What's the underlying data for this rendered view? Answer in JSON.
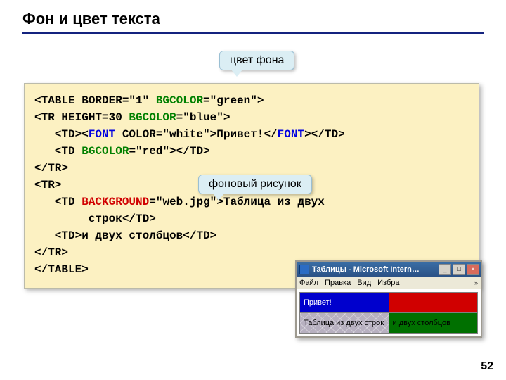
{
  "title": "Фон и цвет текста",
  "callouts": {
    "bgcolor": "цвет фона",
    "background": "фоновый рисунок"
  },
  "code": {
    "l1_a": "<TABLE BORDER=\"1\" ",
    "l1_attr": "BGCOLOR",
    "l1_b": "=\"green\">",
    "l2_a": "<TR HEIGHT=30 ",
    "l2_attr": "BGCOLOR",
    "l2_b": "=\"blue\">",
    "l3_a": "   <TD><",
    "l3_font1": "FONT",
    "l3_b": " COLOR=\"white\">Привет!</",
    "l3_font2": "FONT",
    "l3_c": "></TD>",
    "l4_a": "   <TD ",
    "l4_attr": "BGCOLOR",
    "l4_b": "=\"red\"></TD>",
    "l5": "</TR>",
    "l6": "<TR>",
    "l7_a": "   <TD ",
    "l7_attr": "BACKGROUND",
    "l7_b": "=\"web.jpg\">Таблица из двух",
    "l8": "        строк</TD>",
    "l9": "   <TD>и двух столбцов</TD>",
    "l10": "</TR>",
    "l11": "</TABLE>"
  },
  "window": {
    "title": "Таблицы - Microsoft Intern…",
    "min": "_",
    "max": "□",
    "close": "×",
    "menu": {
      "file": "Файл",
      "edit": "Правка",
      "view": "Вид",
      "fav": "Избра",
      "chev": "»"
    },
    "cells": {
      "r1c1": "Привет!",
      "r1c2": "",
      "r2c1": "Таблица из двух строк",
      "r2c2": "и двух столбцов"
    }
  },
  "page": "52"
}
